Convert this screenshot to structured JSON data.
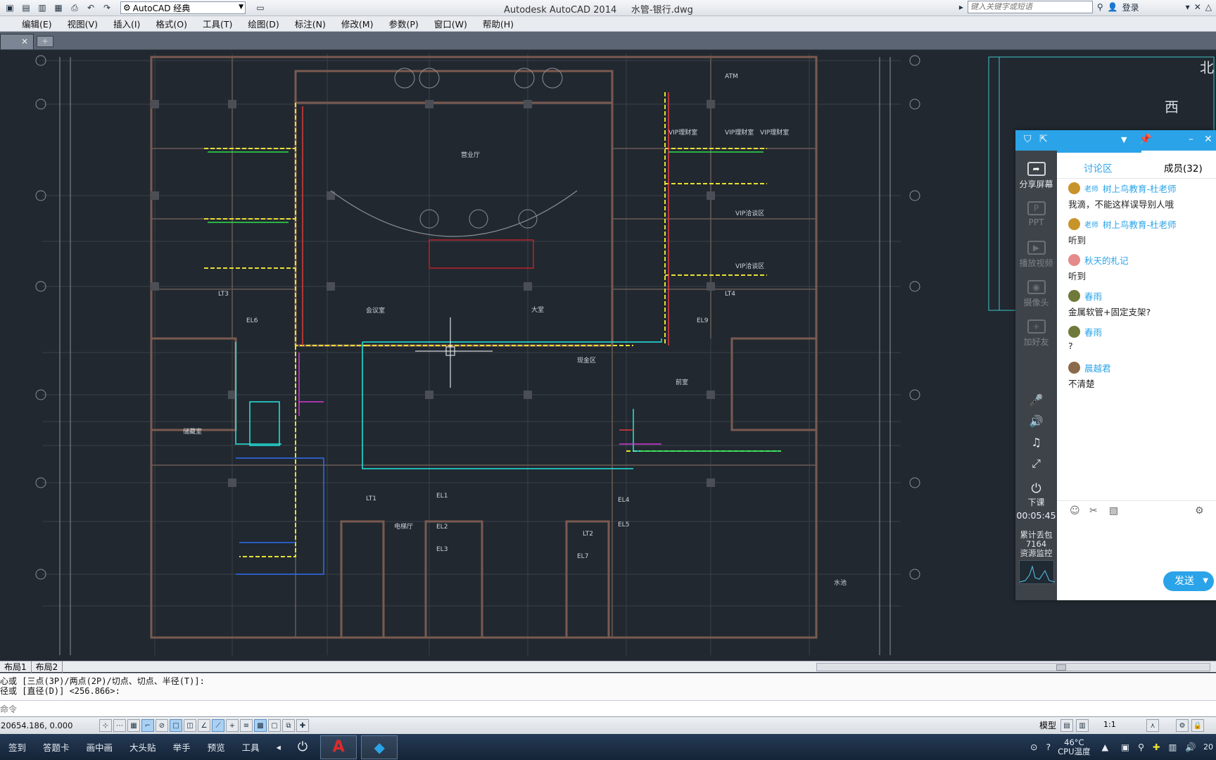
{
  "title_bar": {
    "workspace": "AutoCAD 经典",
    "app_title": "Autodesk AutoCAD 2014",
    "file_name": "水管-银行.dwg",
    "search_placeholder": "键入关键字或短语",
    "login": "登录"
  },
  "menu": [
    "编辑(E)",
    "视图(V)",
    "插入(I)",
    "格式(O)",
    "工具(T)",
    "绘图(D)",
    "标注(N)",
    "修改(M)",
    "参数(P)",
    "窗口(W)",
    "帮助(H)"
  ],
  "drawing": {
    "room_labels": [
      "ATM",
      "VIP理财室",
      "VIP理财室",
      "VIP理财室",
      "VIP洽谈区",
      "VIP洽谈区",
      "营业厅",
      "大堂",
      "LT3",
      "LT4",
      "EL6",
      "EL9",
      "EL1",
      "EL2",
      "EL3",
      "EL4",
      "EL5",
      "EL7",
      "LT1",
      "LT2",
      "现金区",
      "会议室",
      "电梯厅",
      "前室",
      "储藏室",
      "水池"
    ],
    "compass": [
      "北",
      "西"
    ]
  },
  "layout_tabs": [
    "布局1",
    "布局2"
  ],
  "command_line": {
    "history": [
      "心或 [三点(3P)/两点(2P)/切点、切点、半径(T)]:",
      "径或 [直径(D)] <256.866>:"
    ],
    "input_placeholder": "命令"
  },
  "status_bar": {
    "coords": "20654.186, 0.000",
    "model": "模型",
    "scale": "1:1"
  },
  "taskbar": {
    "items": [
      "签到",
      "答题卡",
      "画中画",
      "大头贴",
      "举手",
      "预览",
      "工具"
    ],
    "temp": "46°C",
    "temp_label": "CPU温度",
    "clock": "20"
  },
  "chat": {
    "side_buttons": [
      {
        "label": "分享屏幕",
        "icon": "share-screen-icon",
        "enabled": true
      },
      {
        "label": "PPT",
        "icon": "ppt-icon",
        "enabled": false
      },
      {
        "label": "播放视频",
        "icon": "play-video-icon",
        "enabled": false
      },
      {
        "label": "摄像头",
        "icon": "camera-icon",
        "enabled": false
      },
      {
        "label": "加好友",
        "icon": "add-friend-icon",
        "enabled": false
      }
    ],
    "tabs": {
      "discussion": "讨论区",
      "members": "成员(32)"
    },
    "teacher_tag": "老师",
    "messages": [
      {
        "name": "树上鸟教育-杜老师",
        "teacher": true,
        "text": "我滴，不能这样误导别人哦",
        "avatar_color": "#c8942a"
      },
      {
        "name": "树上鸟教育-杜老师",
        "teacher": true,
        "text": "听到",
        "avatar_color": "#c8942a"
      },
      {
        "name": "秋天的札记",
        "teacher": false,
        "text": "听到",
        "avatar_color": "#e58a8a"
      },
      {
        "name": "春雨",
        "teacher": false,
        "text": "金属软管+固定支架?",
        "avatar_color": "#6f7a3a"
      },
      {
        "name": "春雨",
        "teacher": false,
        "text": "?",
        "avatar_color": "#6f7a3a"
      },
      {
        "name": "晨越君",
        "teacher": false,
        "text": "不清楚",
        "avatar_color": "#8a6a4a"
      }
    ],
    "end_class": "下课",
    "timer": "00:05:45",
    "packet_loss_label": "累计丢包",
    "packet_loss_value": "7164",
    "resource_monitor": "资源监控",
    "send_label": "发送"
  }
}
